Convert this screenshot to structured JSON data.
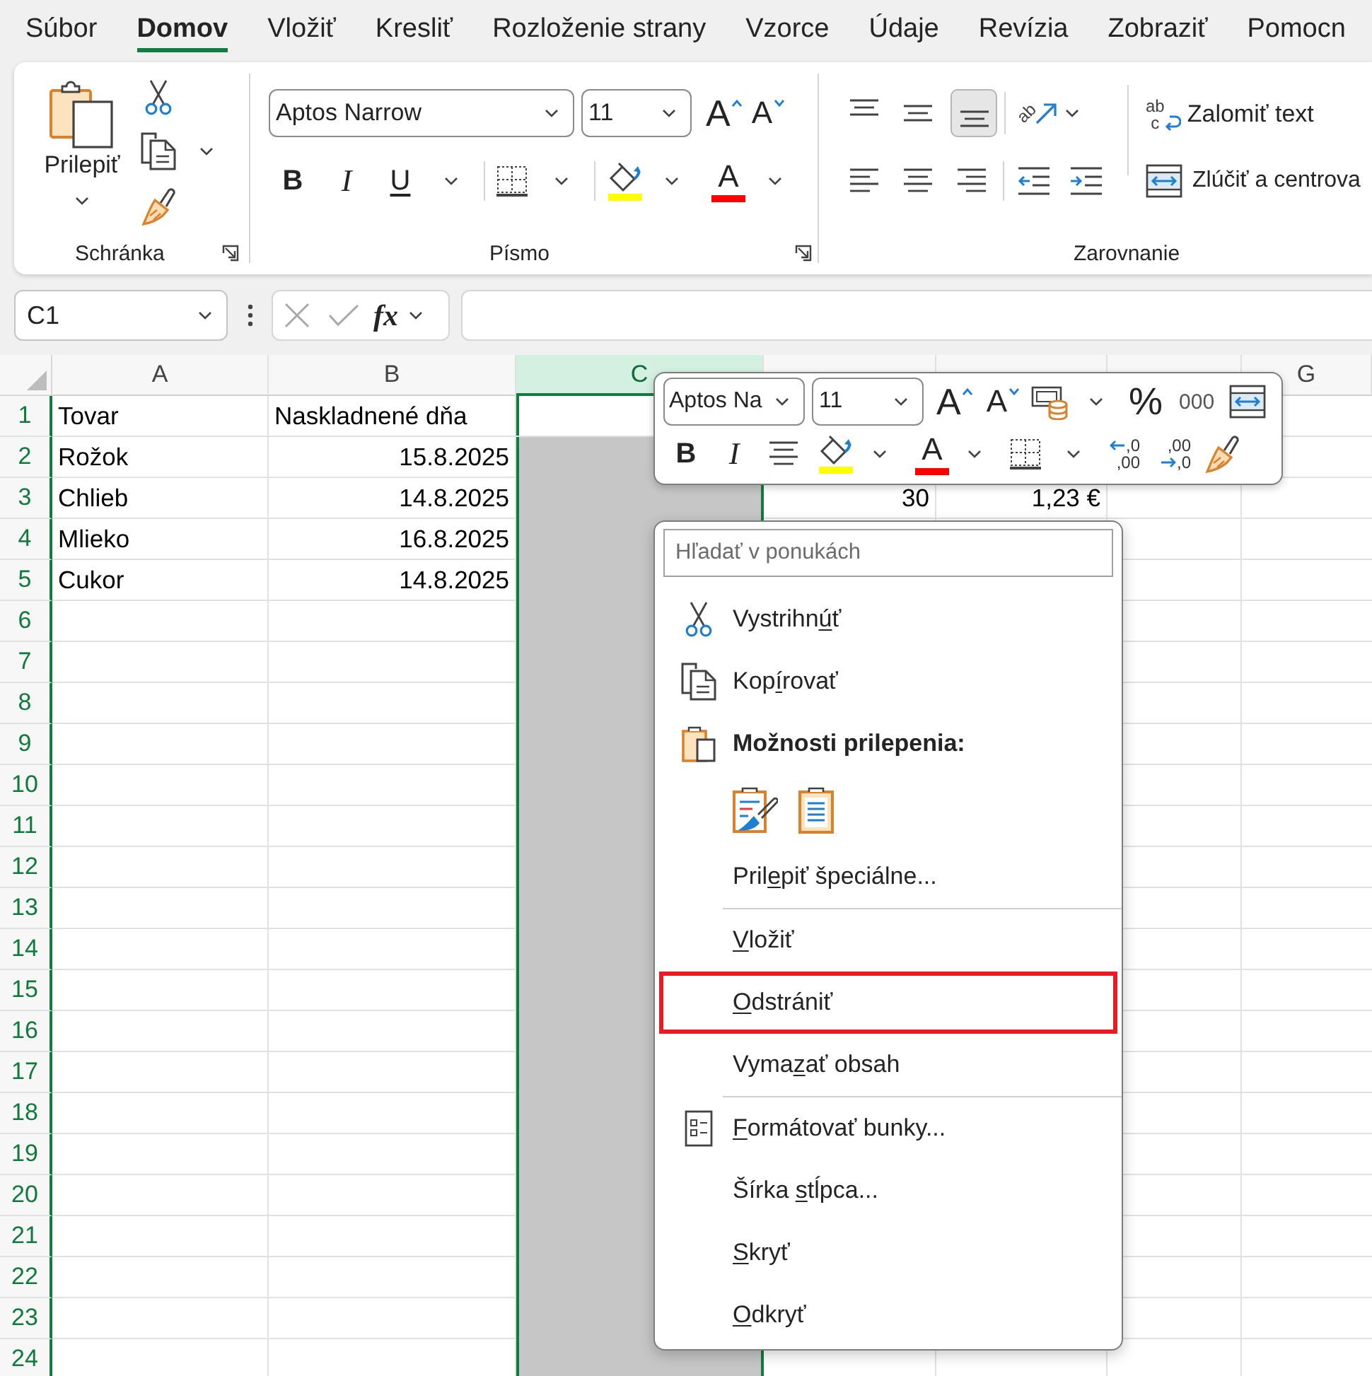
{
  "tabs": [
    {
      "label": "Súbor",
      "selected": false
    },
    {
      "label": "Domov",
      "selected": true
    },
    {
      "label": "Vložiť",
      "selected": false
    },
    {
      "label": "Kresliť",
      "selected": false
    },
    {
      "label": "Rozloženie strany",
      "selected": false
    },
    {
      "label": "Vzorce",
      "selected": false
    },
    {
      "label": "Údaje",
      "selected": false
    },
    {
      "label": "Revízia",
      "selected": false
    },
    {
      "label": "Zobraziť",
      "selected": false
    },
    {
      "label": "Pomocn",
      "selected": false
    }
  ],
  "ribbon": {
    "clipboard": {
      "title": "Schránka",
      "paste": "Prilepiť"
    },
    "font": {
      "title": "Písmo",
      "font_name": "Aptos Narrow",
      "font_size": "11",
      "grow": "A",
      "shrink": "A",
      "bold": "B",
      "italic": "I",
      "underline": "U",
      "font_color": "A"
    },
    "alignment": {
      "title": "Zarovnanie",
      "vertical": [
        {
          "kind": "top",
          "selected": false
        },
        {
          "kind": "middle",
          "selected": false
        },
        {
          "kind": "bottom",
          "selected": true
        }
      ],
      "orientation": "ab",
      "wrap_text": {
        "icon_text": [
          "ab",
          "c"
        ],
        "label": "Zalomiť text"
      },
      "merge": "Zlúčiť a centrova"
    }
  },
  "formula_bar": {
    "name_box": "C1",
    "function_label": "fx"
  },
  "columns": [
    {
      "label": "A",
      "selected": false
    },
    {
      "label": "B",
      "selected": false
    },
    {
      "label": "C",
      "selected": true
    },
    {
      "selected": false
    },
    {
      "selected": false
    },
    {
      "selected": false
    },
    {
      "label": "G",
      "selected": false
    }
  ],
  "rows": [
    {
      "number": "1",
      "active": true,
      "cells": [
        {
          "kind": "text",
          "text": "Tovar"
        },
        {
          "kind": "text",
          "text": "Naskladnené dňa"
        }
      ]
    },
    {
      "number": "2",
      "active": false,
      "cells": [
        {
          "kind": "text",
          "text": "Rožok"
        },
        {
          "kind": "number",
          "text": "15.8.2025"
        }
      ]
    },
    {
      "number": "3",
      "active": false,
      "cells": [
        {
          "kind": "text",
          "text": "Chlieb"
        },
        {
          "kind": "number",
          "text": "14.8.2025"
        },
        null,
        {
          "kind": "number",
          "text": "30"
        },
        {
          "kind": "number",
          "text": "1,23 €"
        }
      ]
    },
    {
      "number": "4",
      "active": false,
      "cells": [
        {
          "kind": "text",
          "text": "Mlieko"
        },
        {
          "kind": "number",
          "text": "16.8.2025"
        }
      ]
    },
    {
      "number": "5",
      "active": false,
      "cells": [
        {
          "kind": "text",
          "text": "Cukor"
        },
        {
          "kind": "number",
          "text": "14.8.2025"
        }
      ]
    },
    {
      "number": "6",
      "active": false
    },
    {
      "number": "7",
      "active": false
    },
    {
      "number": "8",
      "active": false
    },
    {
      "number": "9",
      "active": false
    },
    {
      "number": "10",
      "active": false
    },
    {
      "number": "11",
      "active": false
    },
    {
      "number": "12",
      "active": false
    },
    {
      "number": "13",
      "active": false
    },
    {
      "number": "14",
      "active": false
    },
    {
      "number": "15",
      "active": false
    },
    {
      "number": "16",
      "active": false
    },
    {
      "number": "17",
      "active": false
    },
    {
      "number": "18",
      "active": false
    },
    {
      "number": "19",
      "active": false
    },
    {
      "number": "20",
      "active": false
    },
    {
      "number": "21",
      "active": false
    },
    {
      "number": "22",
      "active": false
    },
    {
      "number": "23",
      "active": false
    },
    {
      "number": "24",
      "active": false
    }
  ],
  "mini_toolbar": {
    "font_name": "Aptos Na",
    "font_size": "11",
    "grow": "A",
    "shrink": "A",
    "percent": "%",
    "thousands": "000",
    "bold": "B",
    "italic": "I",
    "font_color": "A",
    "increase_decimal": [
      ",0",
      ",00"
    ],
    "decrease_decimal": [
      ",00",
      ",0"
    ]
  },
  "context_menu": {
    "search": {
      "placeholder": "Hľadať v ponukách"
    },
    "items": [
      {
        "kind": "cut",
        "label": {
          "before": "Vystrihn",
          "key": "ú",
          "after": "ť"
        },
        "highlighted": false
      },
      {
        "kind": "copy",
        "label": {
          "before": "Kop",
          "key": "í",
          "after": "rovať"
        },
        "highlighted": false
      },
      {
        "kind": "heading",
        "text": "Možnosti prilepenia:"
      },
      {
        "kind": "paste_options"
      },
      {
        "kind": "plain",
        "label": {
          "before": "Pril",
          "key": "e",
          "after": "piť špeciálne..."
        },
        "highlighted": false
      },
      {
        "kind": "separator"
      },
      {
        "kind": "plain",
        "label": {
          "key": "V",
          "after": "ložiť"
        },
        "highlighted": false
      },
      {
        "kind": "plain",
        "label": {
          "key": "O",
          "after": "dstrániť"
        },
        "highlighted": true
      },
      {
        "kind": "plain",
        "label": {
          "before": "Vyma",
          "key": "z",
          "after": "ať obsah"
        },
        "highlighted": false
      },
      {
        "kind": "separator"
      },
      {
        "kind": "format_cells",
        "label": {
          "key": "F",
          "after": "ormátovať bunky..."
        },
        "highlighted": false
      },
      {
        "kind": "plain",
        "label": {
          "before": "Šírka ",
          "key": "s",
          "after": "tĺpca..."
        },
        "highlighted": false
      },
      {
        "kind": "plain",
        "label": {
          "key": "S",
          "after": "kryť"
        },
        "highlighted": false
      },
      {
        "kind": "plain",
        "label": {
          "key": "O",
          "after": "dkryť"
        },
        "highlighted": false
      }
    ]
  }
}
